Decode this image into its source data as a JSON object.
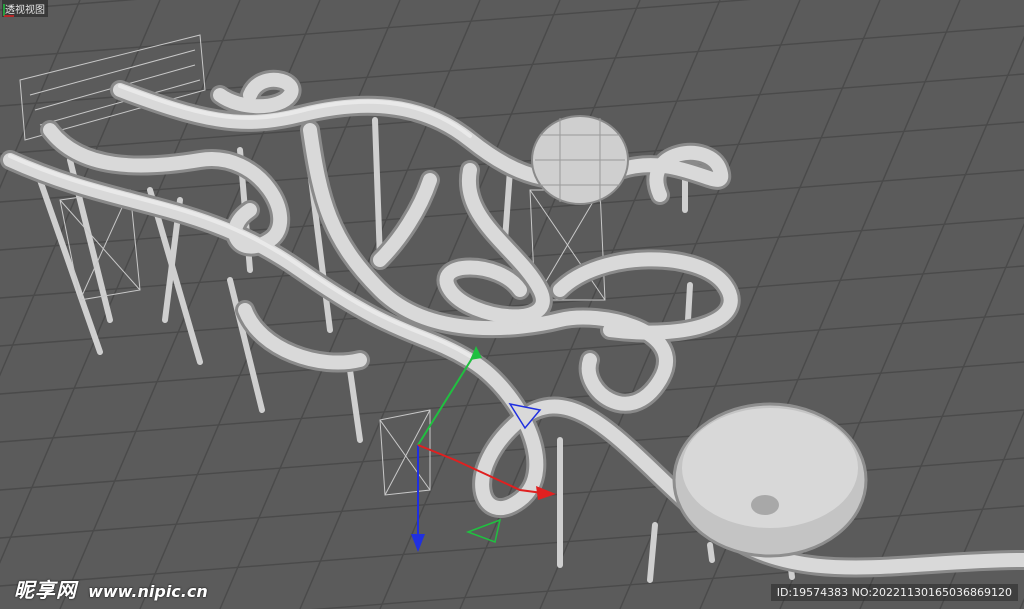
{
  "viewport": {
    "view_label": "透视视图",
    "background": "#5b5b5b",
    "grid_color": "#4a4a4a",
    "model_color": "#d6d6d6",
    "gizmo": {
      "x_color": "#e02020",
      "y_color": "#20c040",
      "z_color": "#2030e0"
    }
  },
  "watermark": {
    "brand": "昵享网",
    "site": "www.nipic.cn"
  },
  "image_id": "ID:19574383 NO:20221130165036869120"
}
